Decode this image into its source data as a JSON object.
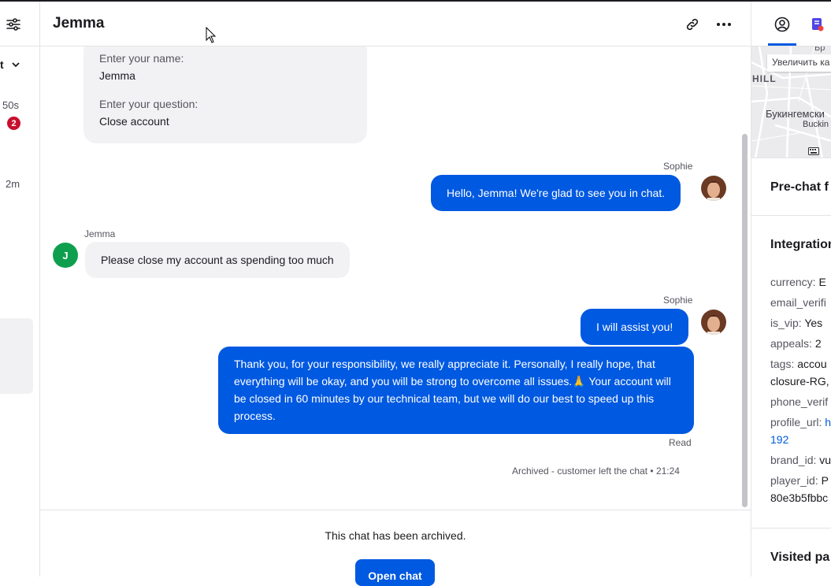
{
  "left_rail": {
    "dropdown_label": "t",
    "time1": "50s",
    "badge_count": "2",
    "time2": "2m"
  },
  "header": {
    "title": "Jemma"
  },
  "prechat_form": {
    "fields": [
      {
        "label": "Enter your name:",
        "value": "Jemma"
      },
      {
        "label": "Enter your question:",
        "value": "Close account"
      }
    ]
  },
  "messages": {
    "m1_author": "Sophie",
    "m1_text": "Hello, Jemma! We're glad to see you in chat.",
    "m2_author": "Jemma",
    "m2_avatar_initial": "J",
    "m2_text": "Please close my account as spending too much",
    "m3_author": "Sophie",
    "m3_text": "I will assist you!",
    "m4_text": "Thank you, for your responsibility, we really appreciate it. Personally, I really hope, that everything will be okay, and you will be strong to overcome all issues.🙏 Your account will be closed in 60 minutes by our technical team, but we will do our best to speed up this process.",
    "read_status": "Read",
    "archived_status": "Archived - customer left the chat • 21:24"
  },
  "footer": {
    "archived_message": "This chat has been archived.",
    "open_chat_label": "Open chat"
  },
  "right_panel": {
    "map": {
      "zoom_label": "Увеличить ка",
      "area_label": "HILL",
      "top_label": "Бр",
      "place_name": "Букингемски",
      "place_sub": "Buckin"
    },
    "prechat_title": "Pre-chat f",
    "integration_title": "Integration",
    "fields": {
      "currency_k": "currency:",
      "currency_v": "E",
      "email_k": "email_verifi",
      "vip_k": "is_vip:",
      "vip_v": "Yes",
      "appeals_k": "appeals:",
      "appeals_v": "2",
      "tags_k": "tags:",
      "tags_v": "accou",
      "tags_v2": "closure-RG,",
      "phone_k": "phone_verif",
      "profile_k": "profile_url:",
      "profile_v": "h",
      "profile_v2": "192",
      "brand_k": "brand_id:",
      "brand_v": "vu",
      "player_k": "player_id:",
      "player_v": "P",
      "player_v2": "80e3b5fbbc"
    },
    "visited_title": "Visited pa"
  },
  "colors": {
    "accent": "#0059e1",
    "badge": "#c8102e",
    "customer_avatar": "#0e9f4e"
  }
}
